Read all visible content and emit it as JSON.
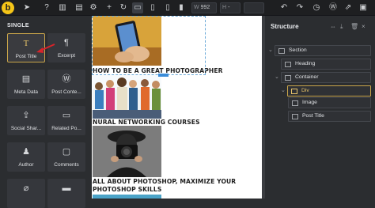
{
  "toolbar": {
    "logo": "b",
    "width_label": "W",
    "width_value": "992",
    "height_label": "H",
    "height_value": "-"
  },
  "left_panel": {
    "section_title": "SINGLE",
    "elements": [
      {
        "label": "Post Title",
        "icon": "title-icon",
        "glyph": "T"
      },
      {
        "label": "Excerpt",
        "icon": "paragraph-icon",
        "glyph": "¶"
      },
      {
        "label": "Meta Data",
        "icon": "document-icon",
        "glyph": "▤"
      },
      {
        "label": "Post Conte...",
        "icon": "wordpress-icon",
        "glyph": "Ⓦ"
      },
      {
        "label": "Social Shar...",
        "icon": "share-icon",
        "glyph": "⇪"
      },
      {
        "label": "Related Po...",
        "icon": "related-posts-icon",
        "glyph": "▭"
      },
      {
        "label": "Author",
        "icon": "user-icon",
        "glyph": "♟"
      },
      {
        "label": "Comments",
        "icon": "comment-icon",
        "glyph": "▢"
      },
      {
        "label": "",
        "icon": "attachment-icon",
        "glyph": "⌀"
      },
      {
        "label": "",
        "icon": "divider-icon",
        "glyph": "▬"
      }
    ]
  },
  "canvas": {
    "posts": [
      {
        "title": "HOW TO BE A GREAT PHOTOGRAPHER",
        "image": "phone-photo"
      },
      {
        "title": "NURAL NETWORKING COURSES",
        "image": "students-photo"
      },
      {
        "title": "ALL ABOUT PHOTOSHOP, MAXIMIZE YOUR PHOTOSHOP SKILLS",
        "image": "photographer-photo"
      }
    ]
  },
  "structure_panel": {
    "title": "Structure",
    "nodes": [
      {
        "label": "Section",
        "icon": "section-icon"
      },
      {
        "label": "Heading",
        "icon": "heading-icon"
      },
      {
        "label": "Container",
        "icon": "container-icon"
      },
      {
        "label": "Div",
        "icon": "div-icon"
      },
      {
        "label": "Image",
        "icon": "image-icon"
      },
      {
        "label": "Post Title",
        "icon": "post-title-icon"
      }
    ]
  },
  "colors": {
    "accent": "#e8c46a",
    "selection": "#3c8dd9",
    "arrow": "#d8232a",
    "panel_bg": "#2b2d30"
  }
}
